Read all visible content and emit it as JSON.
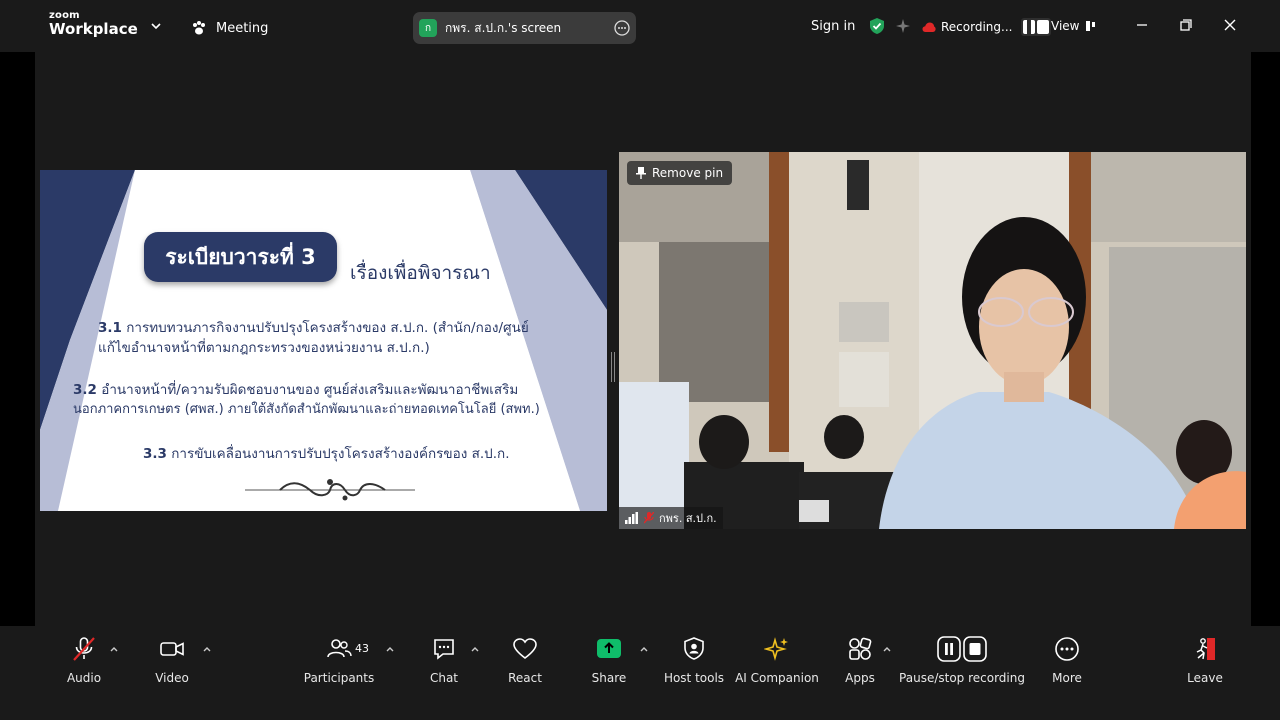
{
  "app": {
    "logo_top": "zoom",
    "logo_bottom": "Workplace"
  },
  "header": {
    "meeting_label": "Meeting",
    "share_badge": "ก",
    "share_label": "กพร. ส.ป.ก.'s screen",
    "sign_in": "Sign in",
    "recording_label": "Recording...",
    "view_label": "View"
  },
  "slide": {
    "heading": "ระเบียบวาระที่ 3",
    "subheading": "เรื่องเพื่อพิจารณา",
    "item1_num": "3.1",
    "item1_line1": "การทบทวนภารกิจงานปรับปรุงโครงสร้างของ ส.ป.ก. (สำนัก/กอง/ศูนย์",
    "item1_line2": "แก้ไขอำนาจหน้าที่ตามกฎกระทรวงของหน่วยงาน ส.ป.ก.)",
    "item2_num": "3.2",
    "item2_line1": "อำนาจหน้าที่/ความรับผิดชอบงานของ ศูนย์ส่งเสริมและพัฒนาอาชีพเสริม",
    "item2_line2": "นอกภาคการเกษตร (ศพส.) ภายใต้สังกัดสำนักพัฒนาและถ่ายทอดเทคโนโลยี (สพท.)",
    "item3_num": "3.3",
    "item3_line1": "การขับเคลื่อนงานการปรับปรุงโครงสร้างองค์กรของ ส.ป.ก."
  },
  "video": {
    "pin_label": "Remove pin",
    "participant_name": "กพร. ส.ป.ก."
  },
  "toolbar": {
    "audio": "Audio",
    "video": "Video",
    "participants": "Participants",
    "participant_count": "43",
    "chat": "Chat",
    "react": "React",
    "share": "Share",
    "host_tools": "Host tools",
    "ai_companion": "AI Companion",
    "apps": "Apps",
    "pause_stop": "Pause/stop recording",
    "more": "More",
    "leave": "Leave"
  },
  "colors": {
    "accent_green": "#22a35a",
    "muted_red": "#e02828",
    "share_green": "#0fbd6a",
    "slide_navy": "#2b3a67"
  }
}
